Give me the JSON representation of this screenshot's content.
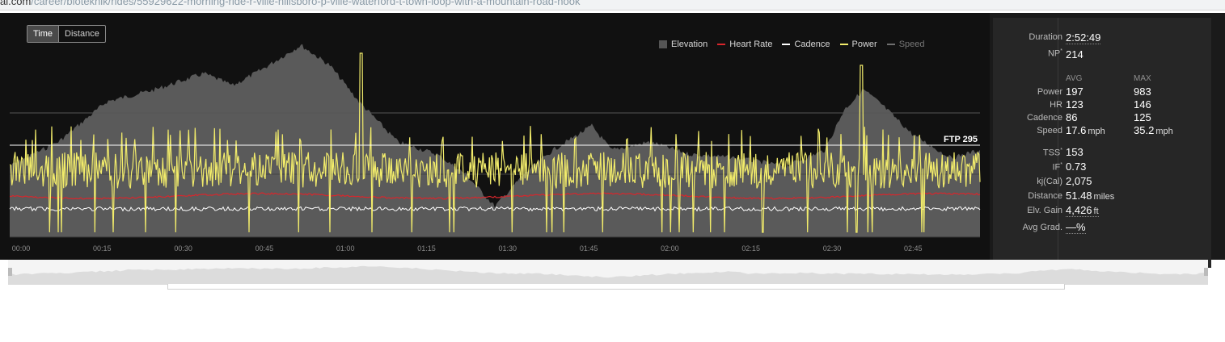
{
  "browser": {
    "url_host": "al.com",
    "url_path": "/career/biotekhik/rides/55929622-morning-ride-r-ville-hillsboro-p-ville-waterford-t-town-loop-with-a-mountain-road-hook"
  },
  "toggle": {
    "time_label": "Time",
    "distance_label": "Distance",
    "active": "Time"
  },
  "legend": {
    "items": [
      {
        "label": "Elevation",
        "color": "#555555",
        "type": "box"
      },
      {
        "label": "Heart Rate",
        "color": "#d9262c",
        "type": "line"
      },
      {
        "label": "Cadence",
        "color": "#ffffff",
        "type": "line"
      },
      {
        "label": "Power",
        "color": "#f2ec6b",
        "type": "line"
      },
      {
        "label": "Speed",
        "color": "#6f6f6f",
        "type": "line"
      }
    ]
  },
  "ftp_label": "FTP 295",
  "chart_data": {
    "type": "line",
    "x_ticks": [
      "00:00",
      "00:15",
      "00:30",
      "00:45",
      "01:00",
      "01:15",
      "01:30",
      "01:45",
      "02:00",
      "02:15",
      "02:30",
      "02:45"
    ],
    "ftp": 295,
    "series": [
      {
        "name": "Elevation",
        "color": "#555555",
        "style": "area"
      },
      {
        "name": "Heart Rate",
        "color": "#d9262c"
      },
      {
        "name": "Cadence",
        "color": "#ffffff"
      },
      {
        "name": "Power",
        "color": "#f2ec6b"
      },
      {
        "name": "Speed",
        "color": "#6f6f6f"
      }
    ]
  },
  "stats": {
    "duration_label": "Duration",
    "duration": "2:52:49",
    "np_label": "NP",
    "np": "214",
    "avg_header": "AVG",
    "max_header": "MAX",
    "rows": [
      {
        "label": "Power",
        "avg": "197",
        "max": "983",
        "unit": ""
      },
      {
        "label": "HR",
        "avg": "123",
        "max": "146",
        "unit": ""
      },
      {
        "label": "Cadence",
        "avg": "86",
        "max": "125",
        "unit": ""
      },
      {
        "label": "Speed",
        "avg": "17.6",
        "max": "35.2",
        "unit": "mph"
      }
    ],
    "tss_label": "TSS",
    "tss": "153",
    "if_label": "IF",
    "if": "0.73",
    "kj_label": "kj(Cal)",
    "kj": "2,075",
    "distance_label": "Distance",
    "distance": "51.48",
    "distance_unit": "miles",
    "elv_label": "Elv. Gain",
    "elv": "4,426",
    "elv_unit": "ft",
    "grad_label": "Avg Grad.",
    "grad": "—%"
  }
}
